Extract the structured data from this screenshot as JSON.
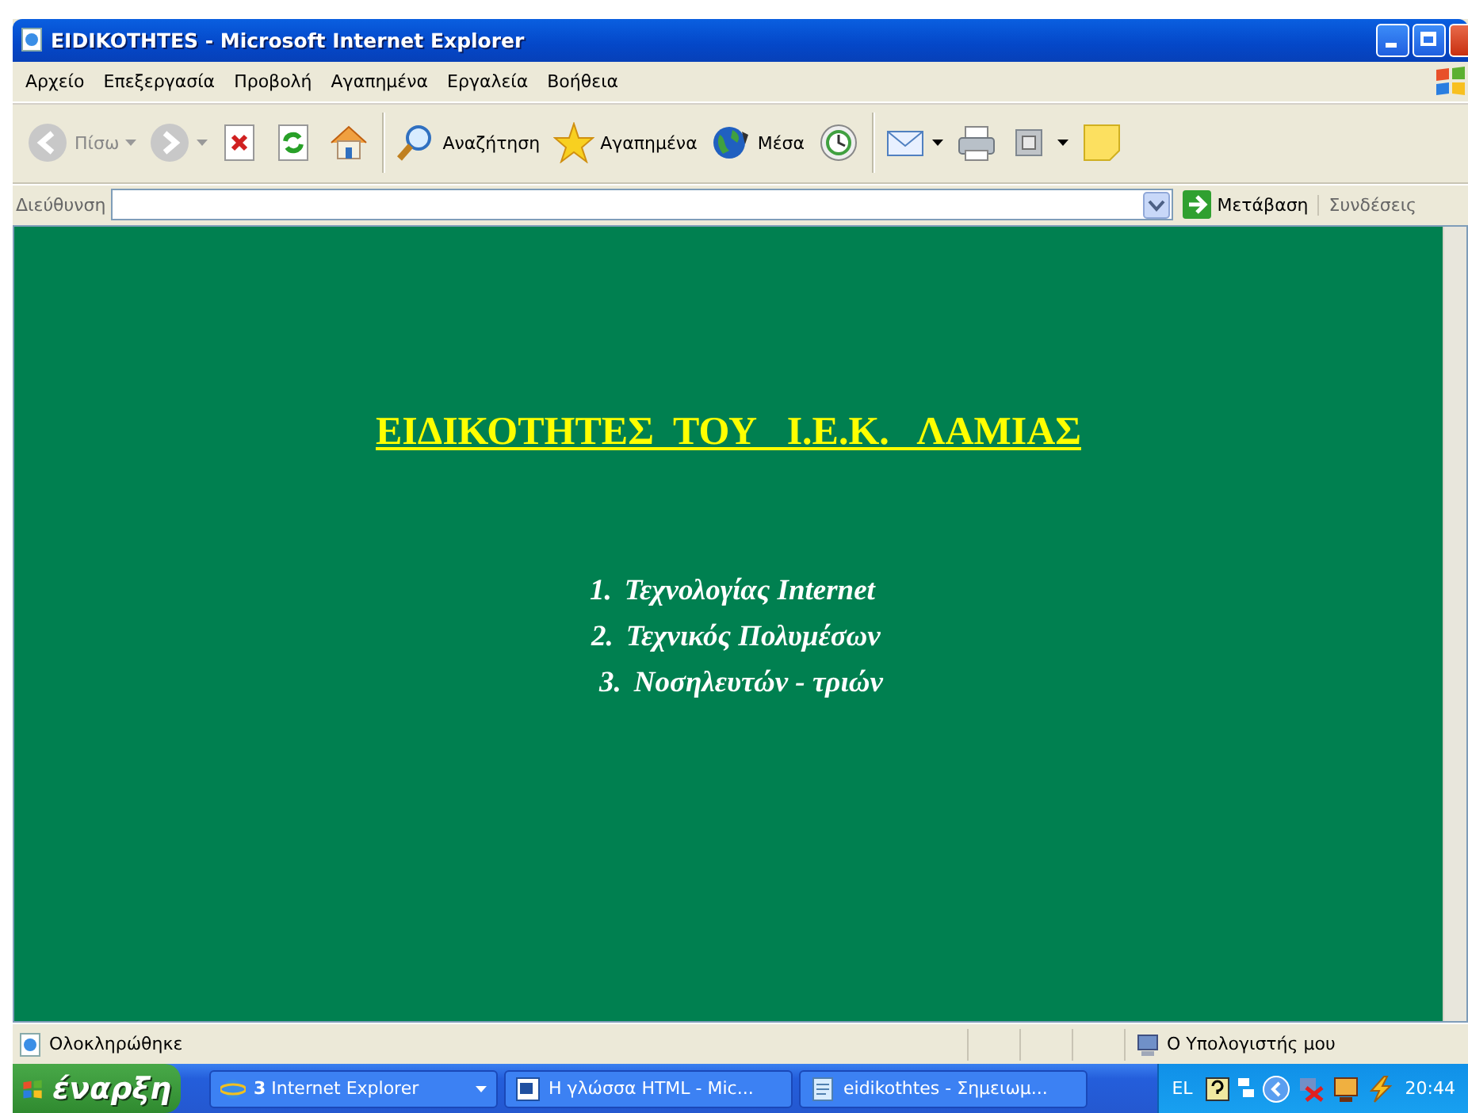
{
  "window": {
    "title": "EIDIKOTHTES - Microsoft Internet Explorer"
  },
  "menu": [
    "Αρχείο",
    "Επεξεργασία",
    "Προβολή",
    "Αγαπημένα",
    "Εργαλεία",
    "Βοήθεια"
  ],
  "toolbar": [
    {
      "kind": "back",
      "label": "Πίσω",
      "disabled": true
    },
    {
      "kind": "forward",
      "disabled": true
    },
    {
      "kind": "stop"
    },
    {
      "kind": "refresh"
    },
    {
      "kind": "home"
    },
    {
      "kind": "sep"
    },
    {
      "kind": "search",
      "label": "Αναζήτηση"
    },
    {
      "kind": "favorites",
      "label": "Αγαπημένα"
    },
    {
      "kind": "media",
      "label": "Μέσα"
    },
    {
      "kind": "history"
    },
    {
      "kind": "sep"
    },
    {
      "kind": "mail"
    },
    {
      "kind": "print"
    },
    {
      "kind": "edit"
    },
    {
      "kind": "notes"
    }
  ],
  "address": {
    "label": "Διεύθυνση",
    "go": "Μετάβαση",
    "links": "Συνδέσεις"
  },
  "page": {
    "heading": "ΕΙΔΙΚΟΤΗΤΕΣ  ΤΟΥ   Ι.Ε.Κ.   ΛΑΜΙΑΣ",
    "items": [
      {
        "number": "1.",
        "text": "Τεχνολογίας Internet"
      },
      {
        "number": "2.",
        "text": "Τεχνικός Πολυμέσων"
      },
      {
        "number": "3.",
        "text": "Νοσηλευτών - τριών"
      }
    ]
  },
  "status_bar": {
    "text": "Ολοκληρώθηκε",
    "zone": "Ο Υπολογιστής μου"
  },
  "taskbar": {
    "start": "έναρξη",
    "tasks": [
      {
        "kind": "ie",
        "count": "3",
        "label": "Internet Explorer",
        "selected": false
      },
      {
        "kind": "word",
        "label": "Η γλώσσα HTML - Mic...",
        "selected": false
      },
      {
        "kind": "notepad",
        "label": "eidikothtes - Σημειωμ...",
        "selected": false
      }
    ],
    "language": "EL",
    "clock": "20:44"
  }
}
